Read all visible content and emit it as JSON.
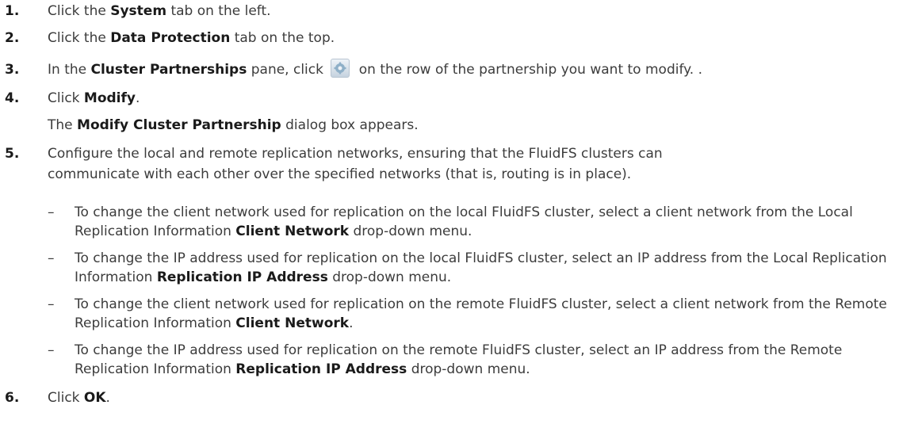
{
  "steps": [
    {
      "num": "1.",
      "pre": "Click the ",
      "bold": "System",
      "post": " tab on the left."
    },
    {
      "num": "2.",
      "pre": "Click the ",
      "bold": "Data Protection",
      "post": " tab on the top."
    },
    {
      "num": "3.",
      "pre": "In the ",
      "bold": "Cluster Partnerships",
      "mid": " pane, click ",
      "post": " on the row of the partnership you want to modify. ."
    },
    {
      "num": "4.",
      "pre": "Click ",
      "bold": "Modify",
      "post": "."
    },
    {
      "num": "5.",
      "line1": "Configure the local and remote replication networks, ensuring that the FluidFS clusters can",
      "line2": "communicate with each other over the specified networks (that is, routing is in place)."
    },
    {
      "num": "6.",
      "pre": "Click ",
      "bold": "OK",
      "post": "."
    }
  ],
  "step4_note": {
    "pre": "The ",
    "bold": "Modify Cluster Partnership",
    "post": " dialog box appears."
  },
  "subitems": [
    {
      "dash": "–",
      "pre": "To change the client network used for replication on the local FluidFS cluster, select a client network from the Local Replication Information ",
      "bold": "Client Network",
      "post": " drop-down menu."
    },
    {
      "dash": "–",
      "pre": "To change the IP address used for replication on the local FluidFS cluster, select an IP address from the Local Replication Information ",
      "bold": "Replication IP Address",
      "post": " drop-down menu."
    },
    {
      "dash": "–",
      "pre": "To change the client network used for replication on the remote FluidFS cluster, select a client network from the Remote Replication Information ",
      "bold": "Client Network",
      "post": "."
    },
    {
      "dash": "–",
      "pre": "To change the IP address used for replication on the remote FluidFS cluster, select an IP address from the Remote Replication Information ",
      "bold": "Replication IP Address",
      "post": " drop-down menu."
    }
  ],
  "icons": {
    "action_button": "gear-icon",
    "accent": "#8fb0c8"
  }
}
